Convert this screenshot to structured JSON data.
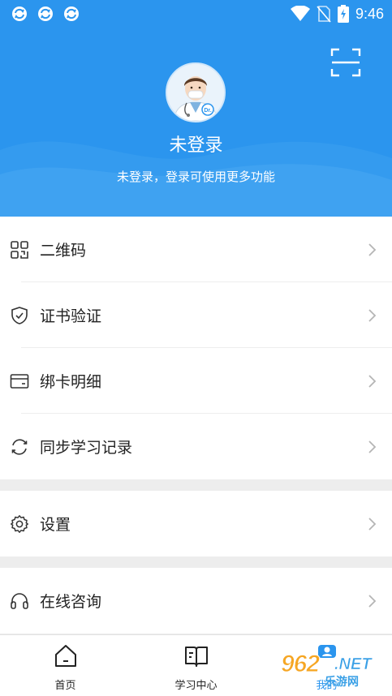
{
  "status_bar": {
    "time": "9:46",
    "left_icons": [
      "sync-app-icon",
      "sync-app-icon",
      "sync-app-icon"
    ],
    "right_icons": [
      "wifi-icon",
      "no-sim-icon",
      "battery-charging-icon"
    ]
  },
  "header": {
    "username": "未登录",
    "login_hint": "未登录，登录可使用更多功能",
    "scan_icon": "scan-icon",
    "avatar_icon": "doctor-avatar-icon",
    "background_color": "#2b95ee"
  },
  "menu": {
    "group1": [
      {
        "label": "二维码",
        "icon": "qr-code-icon"
      },
      {
        "label": "证书验证",
        "icon": "shield-check-icon"
      },
      {
        "label": "绑卡明细",
        "icon": "card-icon"
      },
      {
        "label": "同步学习记录",
        "icon": "sync-icon"
      }
    ],
    "group2": [
      {
        "label": "设置",
        "icon": "gear-icon"
      }
    ],
    "group3": [
      {
        "label": "在线咨询",
        "icon": "headset-icon"
      }
    ]
  },
  "tabbar": {
    "tabs": [
      {
        "label": "首页",
        "icon": "home-icon"
      },
      {
        "label": "学习中心",
        "icon": "book-icon"
      },
      {
        "label": "我的",
        "icon": "user-icon",
        "active": true
      }
    ],
    "active_color": "#2b95ee"
  },
  "watermark": {
    "number": "962",
    "suffix": ".NET",
    "text": "乐游网"
  }
}
